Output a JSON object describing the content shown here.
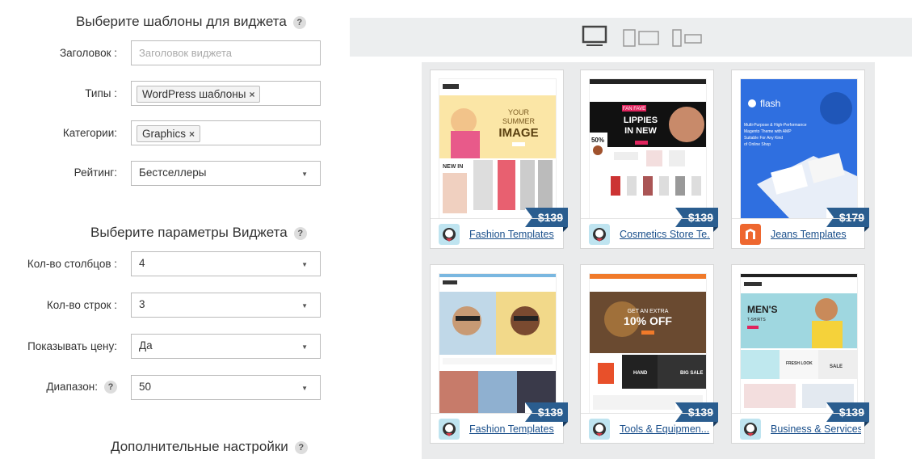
{
  "sections": {
    "templates_title": "Выберите шаблоны для виджета",
    "params_title": "Выберите параметры Виджета",
    "extra_title": "Дополнительные настройки",
    "help": "?"
  },
  "form": {
    "title_label": "Заголовок :",
    "title_placeholder": "Заголовок виджета",
    "types_label": "Типы :",
    "types_tag": "WordPress шаблоны",
    "categories_label": "Категории:",
    "categories_tag": "Graphics",
    "rating_label": "Рейтинг:",
    "rating_value": "Бестселлеры",
    "columns_label": "Кол-во столбцов :",
    "columns_value": "4",
    "rows_label": "Кол-во строк :",
    "rows_value": "3",
    "show_price_label": "Показывать цену:",
    "show_price_value": "Да",
    "range_label": "Диапазон:",
    "range_value": "50",
    "remove": "×",
    "arrow": "▼"
  },
  "devices": [
    "desktop-icon",
    "tablet-icon",
    "mobile-icon"
  ],
  "cards": [
    {
      "price": "$139",
      "category": "Fashion Templates",
      "icon": "prestashop-icon",
      "thumb": {
        "headline": "YOUR SUMMER IMAGE",
        "sub": "NEW IN"
      }
    },
    {
      "price": "$139",
      "category": "Cosmetics Store Te...",
      "icon": "prestashop-icon",
      "thumb": {
        "headline": "LIPPIES IN NEW",
        "sub": "FAN FAVE",
        "badge": "50%"
      }
    },
    {
      "price": "$179",
      "category": "Jeans Templates",
      "icon": "magento-icon",
      "thumb": {
        "headline": "flash",
        "sub": "Multi-Purpose & High-Performance Magento Theme with AMP Suitable For Any Kind of Online Shop"
      }
    },
    {
      "price": "$139",
      "category": "Fashion Templates",
      "icon": "prestashop-icon",
      "thumb": {
        "headline": "",
        "sub": ""
      }
    },
    {
      "price": "$139",
      "category": "Tools & Equipmen...",
      "icon": "prestashop-icon",
      "thumb": {
        "headline": "10% OFF",
        "sub": "GET AN EXTRA",
        "tags": [
          "HAND",
          "BIG SALE"
        ]
      }
    },
    {
      "price": "$139",
      "category": "Business & Services",
      "icon": "prestashop-icon",
      "thumb": {
        "headline": "MEN'S",
        "sub": "T-SHIRTS",
        "tags": [
          "FRESH LOOK",
          "SALE"
        ]
      }
    }
  ]
}
